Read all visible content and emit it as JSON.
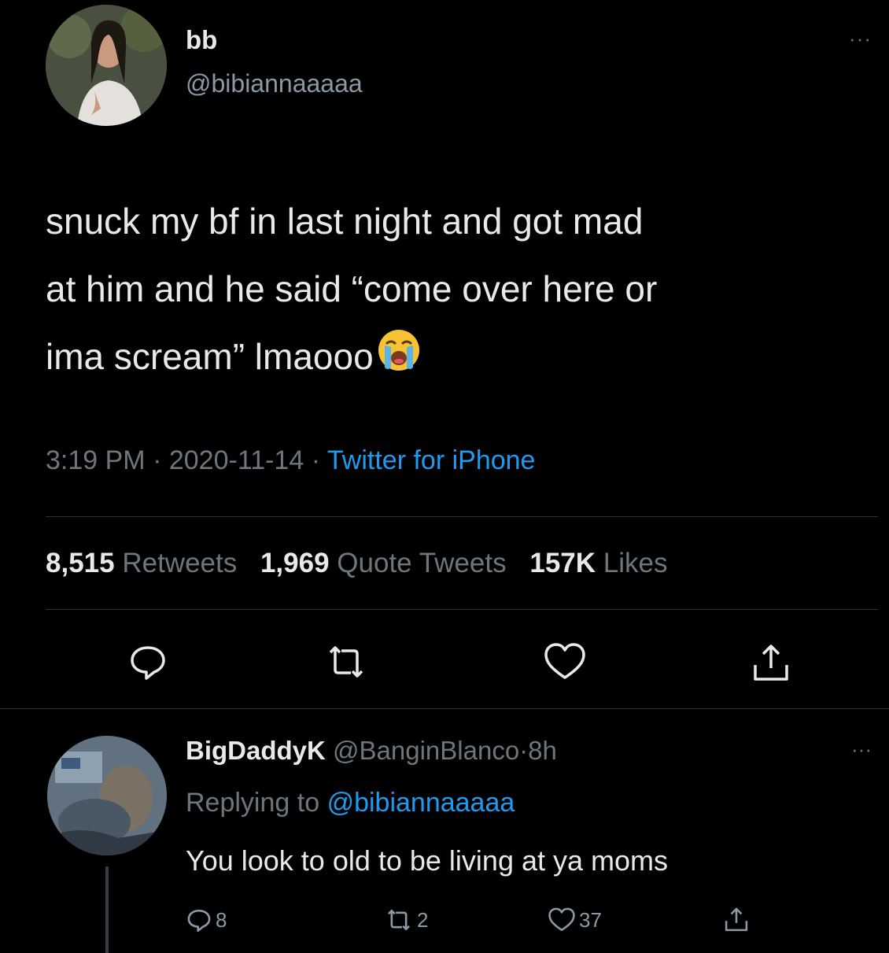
{
  "tweet": {
    "display_name": "bb",
    "handle": "@bibiannaaaaa",
    "text_line1": "snuck my bf in last night and got mad",
    "text_line2": "at him and he said “come over here or",
    "text_line3": "ima scream” lmaooo",
    "emoji": "loudly-crying-face",
    "time": "3:19 PM",
    "date": "2020-11-14",
    "separator": "·",
    "source": "Twitter for iPhone",
    "stats": {
      "retweets_count": "8,515",
      "retweets_label": "Retweets",
      "quotes_count": "1,969",
      "quotes_label": "Quote Tweets",
      "likes_count": "157K",
      "likes_label": "Likes"
    },
    "more_label": "···",
    "actions": [
      "reply-icon",
      "retweet-icon",
      "like-icon",
      "share-icon"
    ]
  },
  "reply": {
    "display_name": "BigDaddyK",
    "handle": "@BanginBlanco",
    "separator": "·",
    "time": "8h",
    "replying_prefix": "Replying to",
    "replying_to": "@bibiannaaaaa",
    "text": "You look to old to be living at ya moms",
    "more_label": "···",
    "counts": {
      "replies": "8",
      "retweets": "2",
      "likes": "37"
    }
  },
  "colors": {
    "background": "#000000",
    "text": "#e7e9ea",
    "muted": "#6e767d",
    "accent": "#1d9bf0",
    "divider": "#2f3336"
  }
}
